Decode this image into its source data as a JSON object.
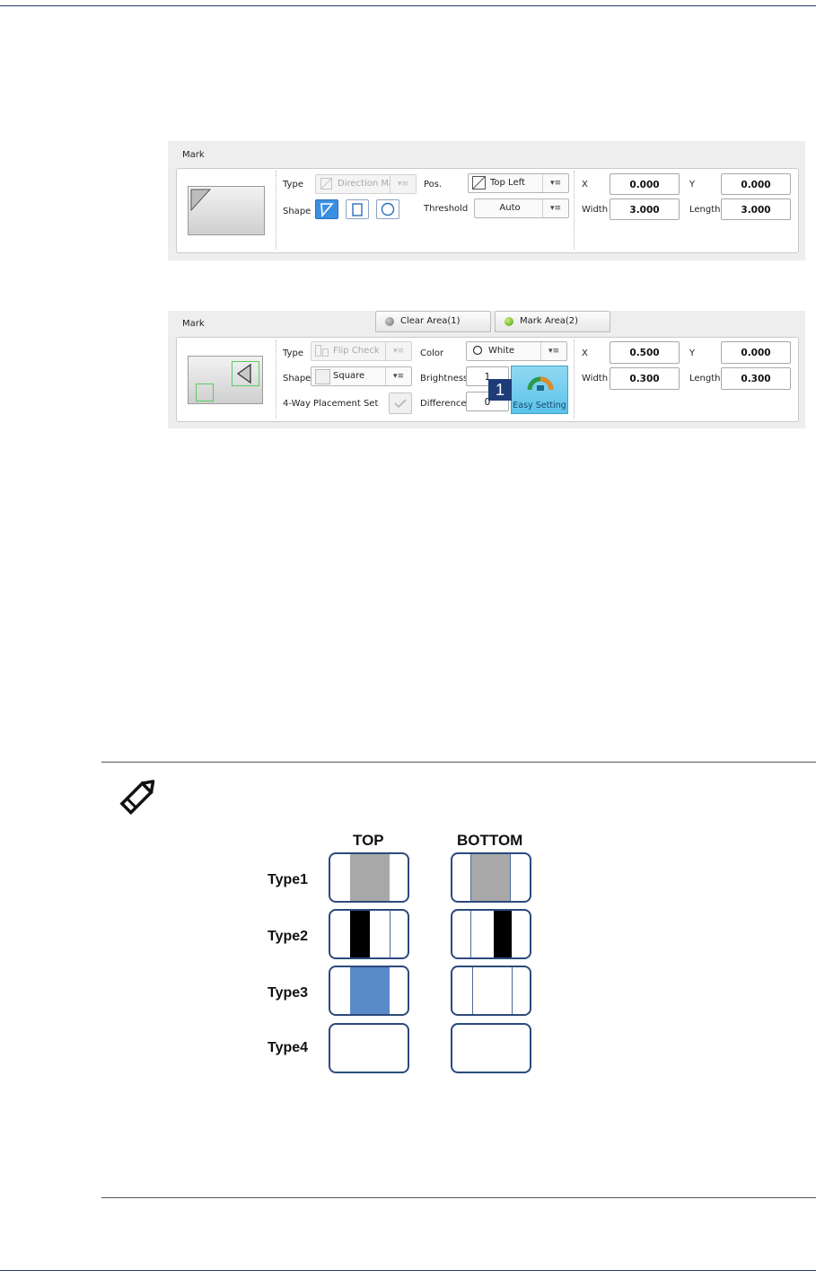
{
  "panel1": {
    "title": "Mark",
    "type_label": "Type",
    "type_value": "Direction Ma",
    "shape_label": "Shape",
    "pos_label": "Pos.",
    "pos_value": "Top Left",
    "threshold_label": "Threshold",
    "threshold_value": "Auto",
    "x_label": "X",
    "x_value": "0.000",
    "y_label": "Y",
    "y_value": "0.000",
    "width_label": "Width",
    "width_value": "3.000",
    "length_label": "Length",
    "length_value": "3.000"
  },
  "panel2": {
    "title": "Mark",
    "tab_clear": "Clear Area(1)",
    "tab_mark": "Mark Area(2)",
    "type_label": "Type",
    "type_value": "Flip Check",
    "shape_label": "Shape",
    "shape_value": "Square",
    "placement_label": "4-Way Placement Set",
    "color_label": "Color",
    "color_value": "White",
    "brightness_label": "Brightness",
    "brightness_value": "1",
    "difference_label": "Difference",
    "difference_value": "0",
    "easy_label": "Easy Setting",
    "badge": "1",
    "x_label": "X",
    "x_value": "0.500",
    "y_label": "Y",
    "y_value": "0.000",
    "width_label": "Width",
    "width_value": "0.300",
    "length_label": "Length",
    "length_value": "0.300"
  },
  "note": {
    "col_top": "TOP",
    "col_bottom": "BOTTOM",
    "types": [
      "Type1",
      "Type2",
      "Type3",
      "Type4"
    ]
  },
  "colors": {
    "rule": "#1f3a6b",
    "accent_blue": "#3b8fe0",
    "chip_gray": "#a8a8a8",
    "chip_black": "#000000",
    "chip_blue": "#5b8ac9",
    "badge": "#1e3c78"
  }
}
